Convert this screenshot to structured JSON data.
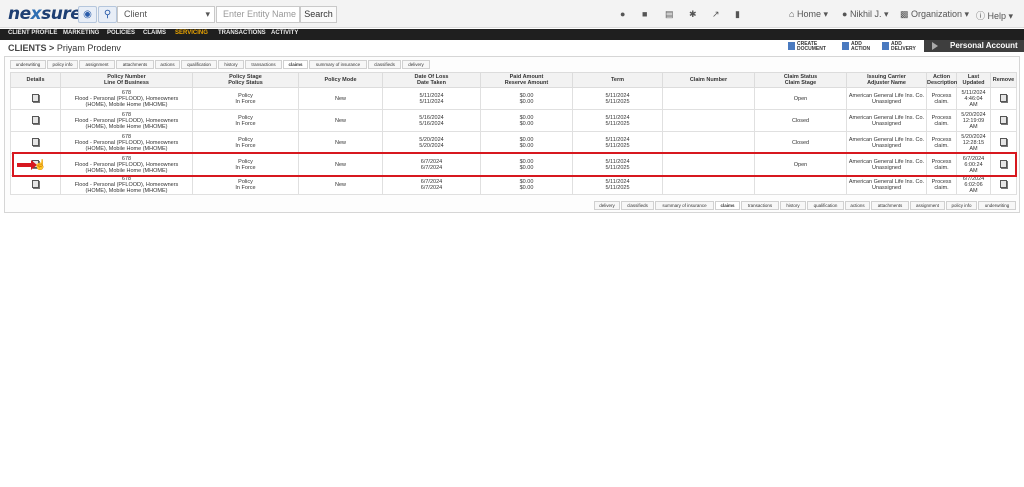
{
  "brand": {
    "logo_left": "ne",
    "logo_x": "x",
    "logo_right": "sure"
  },
  "search": {
    "type_value": "Client",
    "entity_placeholder": "Enter Entity Name",
    "button_label": "Search"
  },
  "topmenu": {
    "home": "Home ▾",
    "user": "Nikhil J. ▾",
    "organization": "Organization ▾",
    "help": "Help ▾"
  },
  "nav": [
    "CLIENT PROFILE",
    "MARKETING",
    "POLICIES",
    "CLAIMS",
    "SERVICING",
    "TRANSACTIONS",
    "ACTIVITY"
  ],
  "nav_active": "SERVICING",
  "breadcrumb": {
    "root": "CLIENTS",
    "sep": ">",
    "client": "Priyam Prodenv"
  },
  "actions": {
    "create_document": [
      "CREATE",
      "DOCUMENT"
    ],
    "add_action": [
      "ADD",
      "ACTION"
    ],
    "add_delivery": [
      "ADD",
      "DELIVERY"
    ]
  },
  "account_tab": "Personal Account",
  "tabs_top": [
    "underwriting",
    "policy info",
    "assignment",
    "attachments",
    "actions",
    "qualification",
    "history",
    "transactions",
    "claims",
    "summary of insurance",
    "classifieds",
    "delivery"
  ],
  "tabs_bottom": [
    "delivery",
    "classifieds",
    "summary of insurance",
    "claims",
    "transactions",
    "history",
    "qualification",
    "actions",
    "attachments",
    "assignment",
    "policy info",
    "underwriting"
  ],
  "tab_selected": "claims",
  "columns": [
    [
      "Details"
    ],
    [
      "Policy Number",
      "Line Of Business"
    ],
    [
      "Policy Stage",
      "Policy Status"
    ],
    [
      "Policy Mode"
    ],
    [
      "Date Of Loss",
      "Date Taken"
    ],
    [
      "Paid Amount",
      "Reserve Amount"
    ],
    [
      "Term"
    ],
    [
      "Claim Number"
    ],
    [
      "Claim Status",
      "Claim Stage"
    ],
    [
      "Issuing Carrier",
      "Adjuster Name"
    ],
    [
      "Action",
      "Description"
    ],
    [
      "Last",
      "Updated"
    ],
    [
      "Remove"
    ]
  ],
  "rows": [
    {
      "policy": [
        "678",
        "Flood - Personal (PFLOOD), Homeowners",
        "(HOME), Mobile Home (MHOME)"
      ],
      "stage": [
        "Policy",
        "In Force"
      ],
      "mode": [
        "New"
      ],
      "loss": [
        "5/11/2024",
        "5/11/2024"
      ],
      "paid": [
        "$0.00",
        "$0.00"
      ],
      "term": [
        "5/11/2024",
        "5/11/2025"
      ],
      "claim_number": [
        ""
      ],
      "status": [
        "Open",
        ""
      ],
      "carrier": [
        "American General Life Ins. Co.",
        "Unassigned"
      ],
      "action": [
        "Process",
        "claim."
      ],
      "updated": [
        "5/11/2024",
        "4:46:04",
        "AM"
      ]
    },
    {
      "policy": [
        "678",
        "Flood - Personal (PFLOOD), Homeowners",
        "(HOME), Mobile Home (MHOME)"
      ],
      "stage": [
        "Policy",
        "In Force"
      ],
      "mode": [
        "New"
      ],
      "loss": [
        "5/16/2024",
        "5/16/2024"
      ],
      "paid": [
        "$0.00",
        "$0.00"
      ],
      "term": [
        "5/11/2024",
        "5/11/2025"
      ],
      "claim_number": [
        ""
      ],
      "status": [
        "Closed",
        ""
      ],
      "carrier": [
        "American General Life Ins. Co.",
        "Unassigned"
      ],
      "action": [
        "Process",
        "claim."
      ],
      "updated": [
        "5/20/2024",
        "12:19:09",
        "AM"
      ]
    },
    {
      "policy": [
        "678",
        "Flood - Personal (PFLOOD), Homeowners",
        "(HOME), Mobile Home (MHOME)"
      ],
      "stage": [
        "Policy",
        "In Force"
      ],
      "mode": [
        "New"
      ],
      "loss": [
        "5/20/2024",
        "5/20/2024"
      ],
      "paid": [
        "$0.00",
        "$0.00"
      ],
      "term": [
        "5/11/2024",
        "5/11/2025"
      ],
      "claim_number": [
        ""
      ],
      "status": [
        "Closed",
        ""
      ],
      "carrier": [
        "American General Life Ins. Co.",
        "Unassigned"
      ],
      "action": [
        "Process",
        "claim."
      ],
      "updated": [
        "5/20/2024",
        "12:28:15",
        "AM"
      ]
    },
    {
      "policy": [
        "678",
        "Flood - Personal (PFLOOD), Homeowners",
        "(HOME), Mobile Home (MHOME)"
      ],
      "stage": [
        "Policy",
        "In Force"
      ],
      "mode": [
        "New"
      ],
      "loss": [
        "6/7/2024",
        "6/7/2024"
      ],
      "paid": [
        "$0.00",
        "$0.00"
      ],
      "term": [
        "5/11/2024",
        "5/11/2025"
      ],
      "claim_number": [
        ""
      ],
      "status": [
        "Open",
        ""
      ],
      "carrier": [
        "American General Life Ins. Co.",
        "Unassigned"
      ],
      "action": [
        "Process",
        "claim."
      ],
      "updated": [
        "6/7/2024",
        "6:00:24",
        "AM"
      ]
    },
    {
      "policy": [
        "678",
        "Flood - Personal (PFLOOD), Homeowners",
        "(HOME), Mobile Home (MHOME)"
      ],
      "stage": [
        "Policy",
        "In Force"
      ],
      "mode": [
        "New"
      ],
      "loss": [
        "6/7/2024",
        "6/7/2024"
      ],
      "paid": [
        "$0.00",
        "$0.00"
      ],
      "term": [
        "5/11/2024",
        "5/11/2025"
      ],
      "claim_number": [
        ""
      ],
      "status": [
        "",
        ""
      ],
      "carrier": [
        "American General Life Ins. Co.",
        "Unassigned"
      ],
      "action": [
        "Process",
        "claim."
      ],
      "updated": [
        "6/7/2024",
        "6:02:06",
        "AM"
      ]
    }
  ],
  "highlight_color": "#d7181f",
  "nav_active_color": "#e9a300"
}
